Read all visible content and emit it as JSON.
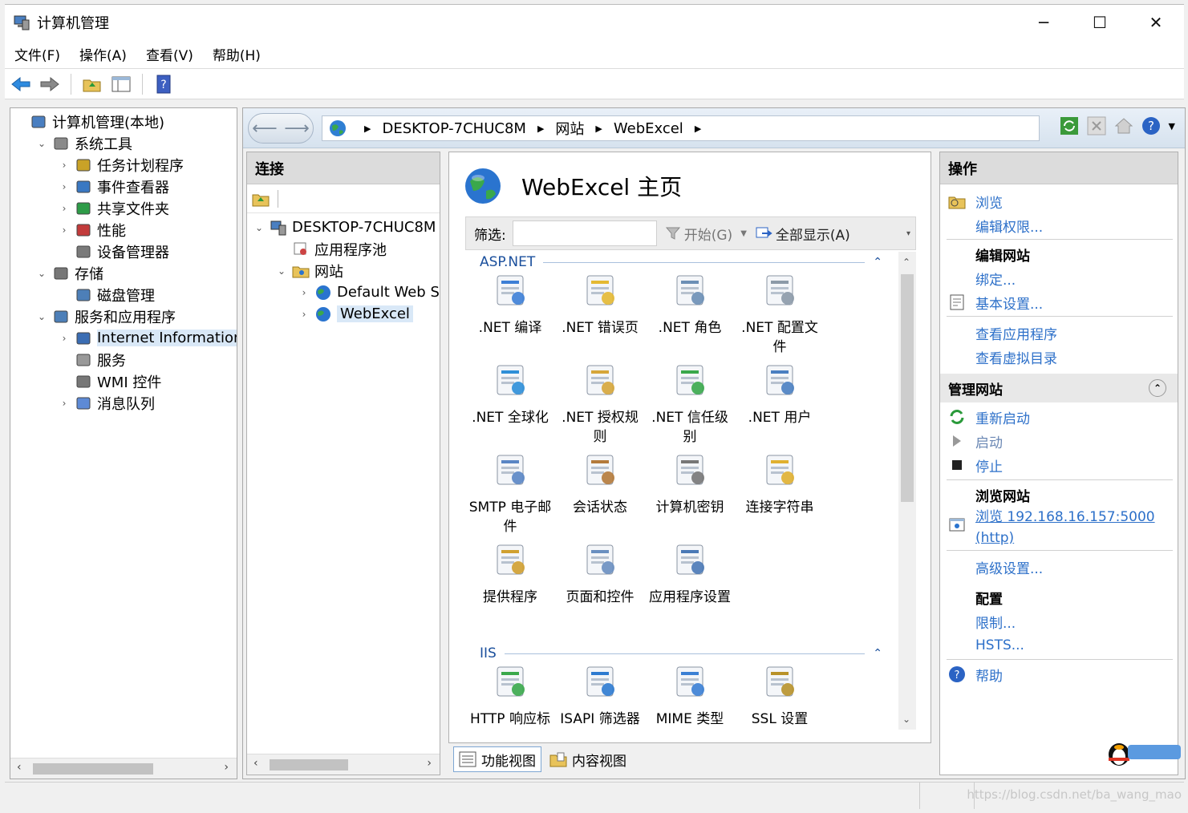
{
  "window": {
    "title": "计算机管理",
    "minimize": "─",
    "maximize": "☐",
    "close": "✕"
  },
  "menu": [
    "文件(F)",
    "操作(A)",
    "查看(V)",
    "帮助(H)"
  ],
  "tree": [
    {
      "label": "计算机管理(本地)",
      "level": 0,
      "chev": ""
    },
    {
      "label": "系统工具",
      "level": 1,
      "chev": "⌄"
    },
    {
      "label": "任务计划程序",
      "level": 2,
      "chev": "›"
    },
    {
      "label": "事件查看器",
      "level": 2,
      "chev": "›"
    },
    {
      "label": "共享文件夹",
      "level": 2,
      "chev": "›"
    },
    {
      "label": "性能",
      "level": 2,
      "chev": "›"
    },
    {
      "label": "设备管理器",
      "level": 2,
      "chev": ""
    },
    {
      "label": "存储",
      "level": 1,
      "chev": "⌄"
    },
    {
      "label": "磁盘管理",
      "level": 2,
      "chev": ""
    },
    {
      "label": "服务和应用程序",
      "level": 1,
      "chev": "⌄"
    },
    {
      "label": "Internet Information Se",
      "level": 2,
      "chev": "›"
    },
    {
      "label": "服务",
      "level": 2,
      "chev": ""
    },
    {
      "label": "WMI 控件",
      "level": 2,
      "chev": ""
    },
    {
      "label": "消息队列",
      "level": 2,
      "chev": "›"
    }
  ],
  "address": {
    "items": [
      "DESKTOP-7CHUC8M",
      "网站",
      "WebExcel"
    ]
  },
  "connections": {
    "title": "连接",
    "nodes": [
      {
        "label": "DESKTOP-7CHUC8M"
      },
      {
        "label": "应用程序池"
      },
      {
        "label": "网站"
      },
      {
        "label": "Default Web S"
      },
      {
        "label": "WebExcel"
      }
    ]
  },
  "content": {
    "page_title": "WebExcel 主页",
    "filter_label": "筛选:",
    "start_label": "开始(G)",
    "show_all_label": "全部显示(A)",
    "groups": [
      {
        "name": "ASP.NET",
        "features": [
          ".NET 编译",
          ".NET 错误页",
          ".NET 角色",
          ".NET 配置文件",
          ".NET 全球化",
          ".NET 授权规则",
          ".NET 信任级别",
          ".NET 用户",
          "SMTP 电子邮件",
          "会话状态",
          "计算机密钥",
          "连接字符串",
          "提供程序",
          "页面和控件",
          "应用程序设置"
        ]
      },
      {
        "name": "IIS",
        "features": [
          "HTTP 响应标",
          "ISAPI 筛选器",
          "MIME 类型",
          "SSL 设置"
        ]
      }
    ],
    "tabs": {
      "features_view": "功能视图",
      "content_view": "内容视图"
    }
  },
  "actions": {
    "title": "操作",
    "browse": "浏览",
    "edit_permissions": "编辑权限...",
    "edit_site_head": "编辑网站",
    "bindings": "绑定...",
    "basic_settings": "基本设置...",
    "view_apps": "查看应用程序",
    "view_vdirs": "查看虚拟目录",
    "manage_head": "管理网站",
    "restart": "重新启动",
    "start": "启动",
    "stop": "停止",
    "browse_head": "浏览网站",
    "browse_url": "浏览 192.168.16.157:5000 (http)",
    "advanced": "高级设置...",
    "config_head": "配置",
    "limits": "限制...",
    "hsts": "HSTS...",
    "help": "帮助"
  },
  "watermark": "https://blog.csdn.net/ba_wang_mao",
  "colors": {
    "link": "#2d70c9",
    "selection": "#d9e8f7",
    "pane_header": "#dcdcdc"
  }
}
